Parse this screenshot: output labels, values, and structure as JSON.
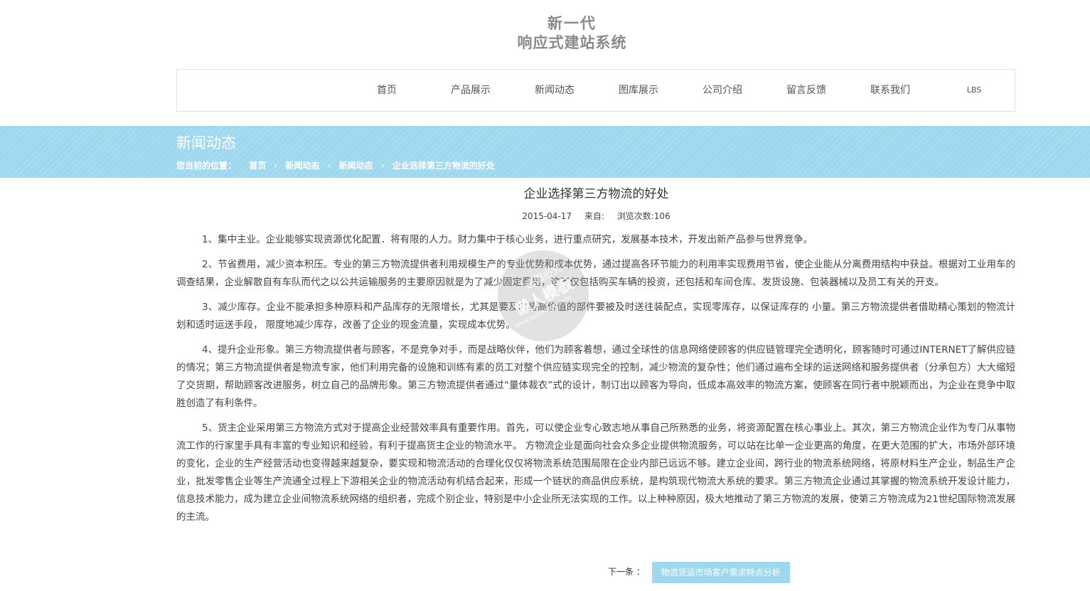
{
  "header": {
    "logo_line1": "新一代",
    "logo_line2": "响应式建站系统"
  },
  "nav": {
    "items": [
      {
        "label": "首页"
      },
      {
        "label": "产品展示"
      },
      {
        "label": "新闻动态"
      },
      {
        "label": "图库展示"
      },
      {
        "label": "公司介绍"
      },
      {
        "label": "留言反馈"
      },
      {
        "label": "联系我们"
      },
      {
        "label": "LBS"
      }
    ]
  },
  "banner": {
    "title": "新闻动态",
    "breadcrumb_lead": "您当前的位置：",
    "breadcrumb": [
      {
        "label": "首页"
      },
      {
        "label": "新闻动态"
      },
      {
        "label": "新闻动态"
      },
      {
        "label": "企业选择第三方物流的好处"
      }
    ],
    "separator": "›"
  },
  "article": {
    "title": "企业选择第三方物流的好处",
    "date": "2015-04-17",
    "source_label": "来自:",
    "views": "浏览次数:106",
    "paragraphs": [
      "1、集中主业。企业能够实现资源优化配置．将有限的人力。财力集中于核心业务，进行重点研究，发展基本技术，开发出新产品参与世界竞争。",
      "2、节省费用，减少资本积压。专业的第三方物流提供者利用规模生产的专业优势和成本优势，通过提高各环节能力的利用率实现费用节省，使企业能从分离费用结构中获益。根据对工业用车的调查结果，企业解散自有车队而代之以公共运输服务的主要原因就是为了减少固定费用，这不仅包括购买车辆的投资，还包括和车间仓库、发货设施、包装器械以及员工有关的开支。",
      "3、减少库存。企业不能承担多种原料和产品库存的无限增长，尤其是要及时将高价值的部件要被及时送往装配点，实现零库存，以保证库存的 小量。第三方物流提供者借助精心策划的物流计划和适时运送手段， 限度地减少库存，改善了企业的现金流量，实现成本优势。",
      "4、提升企业形象。第三方物流提供者与顾客，不是竞争对手，而是战略伙伴，他们为顾客着想，通过全球性的信息网络使顾客的供应链管理完全透明化，顾客随时可通过INTERNET了解供应链的情况；第三方物流提供者是物流专家，他们利用完备的设施和训练有素的员工对整个供应链实现完全的控制，减少物流的复杂性；他们通过遍布全球的运送网络和服务提供者（分承包方）大大缩短了交货期，帮助顾客改进服务，树立自己的品牌形象。第三方物流提供者通过“量体裁衣”式的设计，制订出以顾客为导向，低成本高效率的物流方案，使顾客在同行者中脱颖而出，为企业在竞争中取胜创造了有利条件。",
      "5、货主企业采用第三方物流方式对于提高企业经营效率具有重要作用。首先，可以使企业专心致志地从事自己所熟悉的业务，将资源配置在核心事业上。其次，第三方物流企业作为专门从事物流工作的行家里手具有丰富的专业知识和经验，有利于提高货主企业的物流水平。 方物流企业是面向社会众多企业提供物流服务，可以站在比单一企业更高的角度，在更大范围的扩大，市场外部环境的变化，企业的生产经营活动也变得越来越复杂，要实现和物流活动的合理化仅仅将物流系统范围局限在企业内部已远远不够。建立企业间，跨行业的物流系统网络，将原材料生产企业，制品生产企业，批发零售企业等生产流通全过程上下游相关企业的物流活动有机结合起来，形成一个链状的商品供应系统，是构筑现代物流大系统的要求。第三方物流企业通过其掌握的物流系统开发设计能力，信息技术能力，成为建立企业间物流系统网络的组织者，完成个别企业，特别是中小企业所无法实现的工作。以上种种原因，极大地推动了第三方物流的发展，使第三方物流成为21世纪国际物流发展的主流。"
    ]
  },
  "pager": {
    "next_label": "下一条 ：",
    "next_title": "物流货运市场客户需求特点分析"
  },
  "watermark": {
    "line1": "盗图必究",
    "line2": "懒人模板",
    "line3": "www.lanrenmb.com"
  },
  "colors": {
    "banner": "#9ed8ef",
    "nav_border": "#e1e1e1",
    "logo_text": "#8a8a8a"
  }
}
